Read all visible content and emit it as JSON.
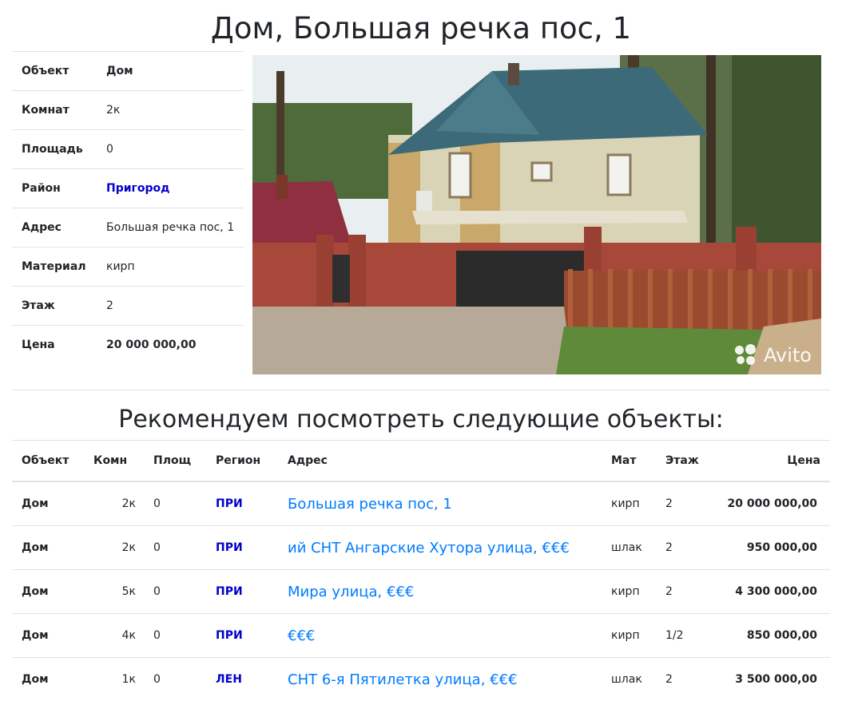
{
  "title": "Дом, Большая речка пос, 1",
  "details": [
    {
      "label": "Объект",
      "value": "Дом",
      "style": "bold"
    },
    {
      "label": "Комнат",
      "value": "2к",
      "style": "normal"
    },
    {
      "label": "Площадь",
      "value": "0",
      "style": "normal"
    },
    {
      "label": "Район",
      "value": "Пригород",
      "style": "link"
    },
    {
      "label": "Адрес",
      "value": "Большая речка пос, 1",
      "style": "normal"
    },
    {
      "label": "Материал",
      "value": "кирп",
      "style": "normal"
    },
    {
      "label": "Этаж",
      "value": "2",
      "style": "normal"
    },
    {
      "label": "Цена",
      "value": "20 000 000,00",
      "style": "bold"
    }
  ],
  "photo": {
    "watermark": "Avito"
  },
  "recommend": {
    "title": "Рекомендуем посмотреть следующие объекты:",
    "headers": {
      "type": "Объект",
      "rooms": "Комн",
      "area": "Площ",
      "region": "Регион",
      "address": "Адрес",
      "material": "Мат",
      "floor": "Этаж",
      "price": "Цена"
    },
    "rows": [
      {
        "type": "Дом",
        "rooms": "2к",
        "area": "0",
        "region": "ПРИ",
        "address": "Большая речка пос, 1",
        "material": "кирп",
        "floor": "2",
        "price": "20 000 000,00"
      },
      {
        "type": "Дом",
        "rooms": "2к",
        "area": "0",
        "region": "ПРИ",
        "address": "ий СНТ Ангарские Хутора улица, €€€",
        "material": "шлак",
        "floor": "2",
        "price": "950 000,00"
      },
      {
        "type": "Дом",
        "rooms": "5к",
        "area": "0",
        "region": "ПРИ",
        "address": "Мира улица, €€€",
        "material": "кирп",
        "floor": "2",
        "price": "4 300 000,00"
      },
      {
        "type": "Дом",
        "rooms": "4к",
        "area": "0",
        "region": "ПРИ",
        "address": "€€€",
        "material": "кирп",
        "floor": "1/2",
        "price": "850 000,00"
      },
      {
        "type": "Дом",
        "rooms": "1к",
        "area": "0",
        "region": "ЛЕН",
        "address": "СНТ 6-я Пятилетка улица, €€€",
        "material": "шлак",
        "floor": "2",
        "price": "3 500 000,00"
      }
    ]
  },
  "colors": {
    "link": "#007bff",
    "region": "#0000cc",
    "border": "#dee2e6",
    "text": "#212529"
  }
}
